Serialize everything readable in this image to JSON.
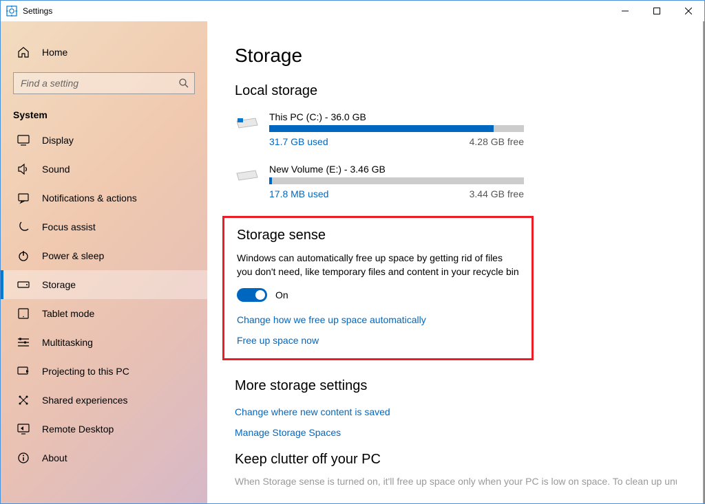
{
  "window": {
    "title": "Settings"
  },
  "sidebar": {
    "home": "Home",
    "search_placeholder": "Find a setting",
    "section": "System",
    "items": [
      {
        "icon": "display-icon",
        "label": "Display"
      },
      {
        "icon": "sound-icon",
        "label": "Sound"
      },
      {
        "icon": "notifications-icon",
        "label": "Notifications & actions"
      },
      {
        "icon": "focus-icon",
        "label": "Focus assist"
      },
      {
        "icon": "power-icon",
        "label": "Power & sleep"
      },
      {
        "icon": "storage-icon",
        "label": "Storage",
        "selected": true
      },
      {
        "icon": "tablet-icon",
        "label": "Tablet mode"
      },
      {
        "icon": "multitask-icon",
        "label": "Multitasking"
      },
      {
        "icon": "projecting-icon",
        "label": "Projecting to this PC"
      },
      {
        "icon": "shared-icon",
        "label": "Shared experiences"
      },
      {
        "icon": "remote-icon",
        "label": "Remote Desktop"
      },
      {
        "icon": "about-icon",
        "label": "About"
      }
    ]
  },
  "main": {
    "title": "Storage",
    "local_storage": {
      "heading": "Local storage",
      "drives": [
        {
          "name": "This PC (C:) - 36.0 GB",
          "used": "31.7 GB used",
          "free": "4.28 GB free",
          "fill_pct": 88
        },
        {
          "name": "New Volume (E:) - 3.46 GB",
          "used": "17.8 MB used",
          "free": "3.44 GB free",
          "fill_pct": 1
        }
      ]
    },
    "storage_sense": {
      "heading": "Storage sense",
      "desc": "Windows can automatically free up space by getting rid of files you don't need, like temporary files and content in your recycle bin",
      "toggle_label": "On",
      "toggle_state": true,
      "link_change": "Change how we free up space automatically",
      "link_freeup": "Free up space now"
    },
    "more": {
      "heading": "More storage settings",
      "link_change_save": "Change where new content is saved",
      "link_manage": "Manage Storage Spaces"
    },
    "keep_clutter": {
      "heading": "Keep clutter off your PC",
      "cutoff": "When Storage sense is turned on, it'll free up space only when your PC is low on space. To clean up unused"
    }
  }
}
